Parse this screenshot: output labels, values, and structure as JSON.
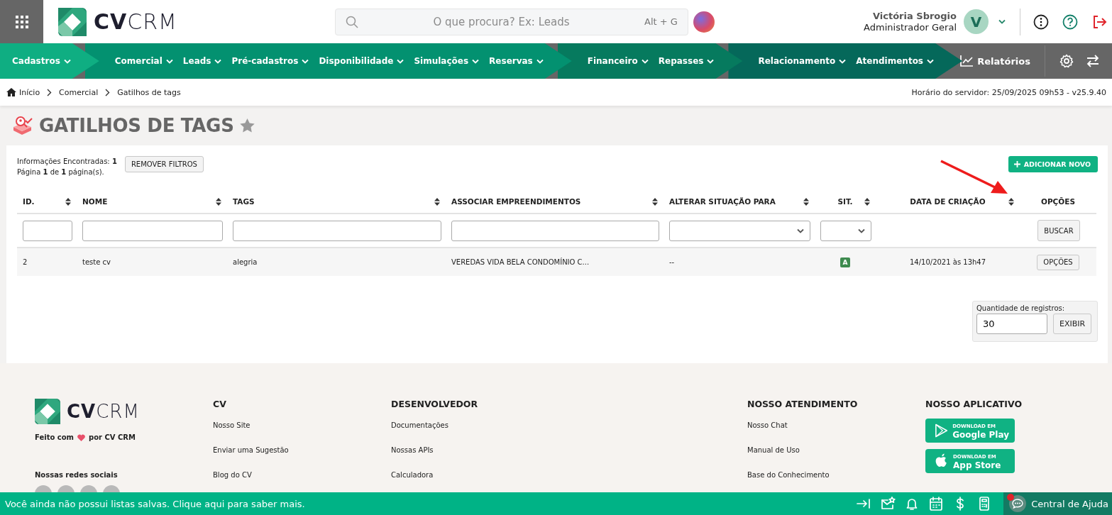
{
  "header": {
    "logo": "**CV**CRM",
    "search": {
      "placeholder": "O que procura? Ex: Leads",
      "shortcut": "Alt + G"
    },
    "user": {
      "name": "Victória Sbrogio",
      "role": "Administrador Geral",
      "initial": "V"
    }
  },
  "nav": {
    "groups": [
      {
        "color": "#0fae82",
        "items": [
          "Cadastros"
        ]
      },
      {
        "color": "#039170",
        "items": [
          "Comercial",
          "Leads",
          "Pré-cadastros",
          "Disponibilidade",
          "Simulações",
          "Reservas"
        ]
      },
      {
        "color": "#067a5e",
        "items": [
          "Financeiro",
          "Repasses"
        ]
      },
      {
        "color": "#05685a",
        "items": [
          "Relacionamento",
          "Atendimentos"
        ]
      }
    ],
    "reports": "Relatórios"
  },
  "breadcrumb": {
    "items": [
      "Início",
      "Comercial",
      "Gatilhos de tags"
    ],
    "server_time": "Horário do servidor: 25/09/2025 09h53 - v25.9.40"
  },
  "page": {
    "title": "GATILHOS DE TAGS",
    "favorite": false
  },
  "summary": {
    "found": "Informações Encontradas: **1**",
    "pages": "Página **1** de **1** página(s).",
    "remove_filters": "REMOVER FILTROS",
    "add_new": "ADICIONAR NOVO"
  },
  "table": {
    "columns": [
      {
        "label": "ID.",
        "sortable": true,
        "kind": "text"
      },
      {
        "label": "NOME",
        "sortable": true,
        "kind": "text"
      },
      {
        "label": "TAGS",
        "sortable": true,
        "kind": "text"
      },
      {
        "label": "ASSOCIAR EMPREENDIMENTOS",
        "sortable": true,
        "kind": "text"
      },
      {
        "label": "ALTERAR SITUAÇÃO PARA",
        "sortable": true,
        "kind": "select"
      },
      {
        "label": "SIT.",
        "sortable": true,
        "kind": "select"
      },
      {
        "label": "DATA DE CRIAÇÃO",
        "sortable": true,
        "kind": "none"
      },
      {
        "label": "OPÇÕES",
        "sortable": false,
        "kind": "button"
      }
    ],
    "search_button": "BUSCAR",
    "rows": [
      {
        "id": "2",
        "name": "teste cv",
        "tags": "alegria",
        "projects": "VEREDAS VIDA BELA CONDOMÍNIO C...",
        "change_status": "--",
        "status": "A",
        "created": "14/10/2021 às 13h47",
        "options": "OPÇÕES"
      }
    ]
  },
  "records": {
    "label": "Quantidade de registros:",
    "value": "30",
    "button": "EXIBIR"
  },
  "footer": {
    "logo": "**CV**CRM",
    "made_with": [
      "Feito com",
      "por CV CRM"
    ],
    "social_title": "Nossas redes sociais",
    "columns": [
      {
        "title": "CV",
        "links": [
          "Nosso Site",
          "Enviar uma Sugestão",
          "Blog do CV"
        ]
      },
      {
        "title": "DESENVOLVEDOR",
        "links": [
          "Documentações",
          "Nossas APIs",
          "Calculadora"
        ]
      },
      {
        "title": "NOSSO ATENDIMENTO",
        "links": [
          "Nosso Chat",
          "Manual de Uso",
          "Base do Conhecimento"
        ]
      }
    ],
    "app_title": "NOSSO APLICATIVO",
    "stores": [
      {
        "kind": "google",
        "small": "DOWNLOAD EM",
        "name": "Google Play"
      },
      {
        "kind": "apple",
        "small": "DOWNLOAD EM",
        "name": "App Store"
      }
    ]
  },
  "bottom_bar": {
    "message": "Você ainda não possui listas salvas. Clique aqui para saber mais.",
    "help": "Central de Ajuda",
    "help_notification": true
  }
}
